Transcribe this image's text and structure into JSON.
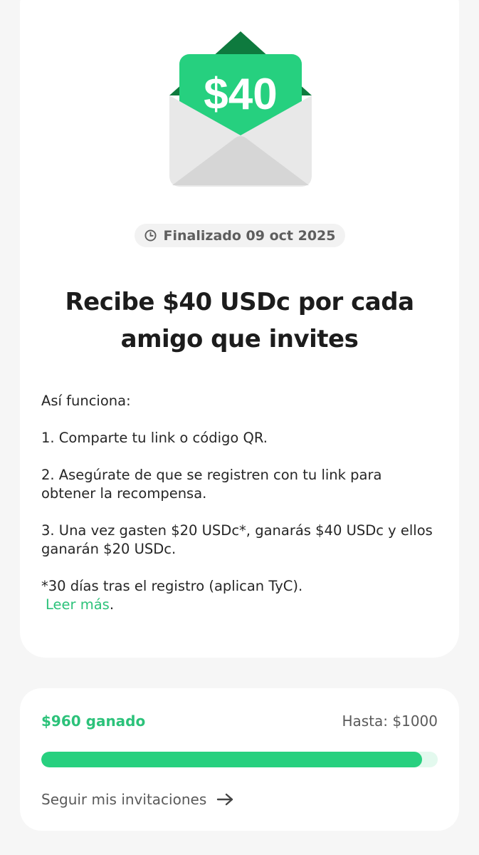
{
  "hero": {
    "amount_label": "$40",
    "colors": {
      "card": "#26D07F",
      "envelope_back": "#0E7A3E",
      "envelope_body": "#E8E8E8"
    }
  },
  "status": {
    "icon": "clock-icon",
    "text": "Finalizado 09 oct 2025"
  },
  "title": "Recibe $40 USDc por cada amigo que invites",
  "how_it_works": {
    "heading": "Así funciona:",
    "steps": [
      "1. Comparte tu link o código QR.",
      "2. Asegúrate de que se registren con tu link para obtener la recompensa.",
      "3. Una vez gasten $20 USDc*, ganarás $40 USDc y ellos ganarán $20 USDc."
    ],
    "footnote": "*30 días tras el registro (aplican TyC).",
    "read_more": "Leer más",
    "read_more_suffix": "."
  },
  "progress": {
    "earned_label": "$960 ganado",
    "limit_label": "Hasta: $1000",
    "fraction": 0.96,
    "accent": "#27D07F",
    "follow_label": "Seguir mis invitaciones",
    "follow_icon": "arrow-right-icon"
  }
}
